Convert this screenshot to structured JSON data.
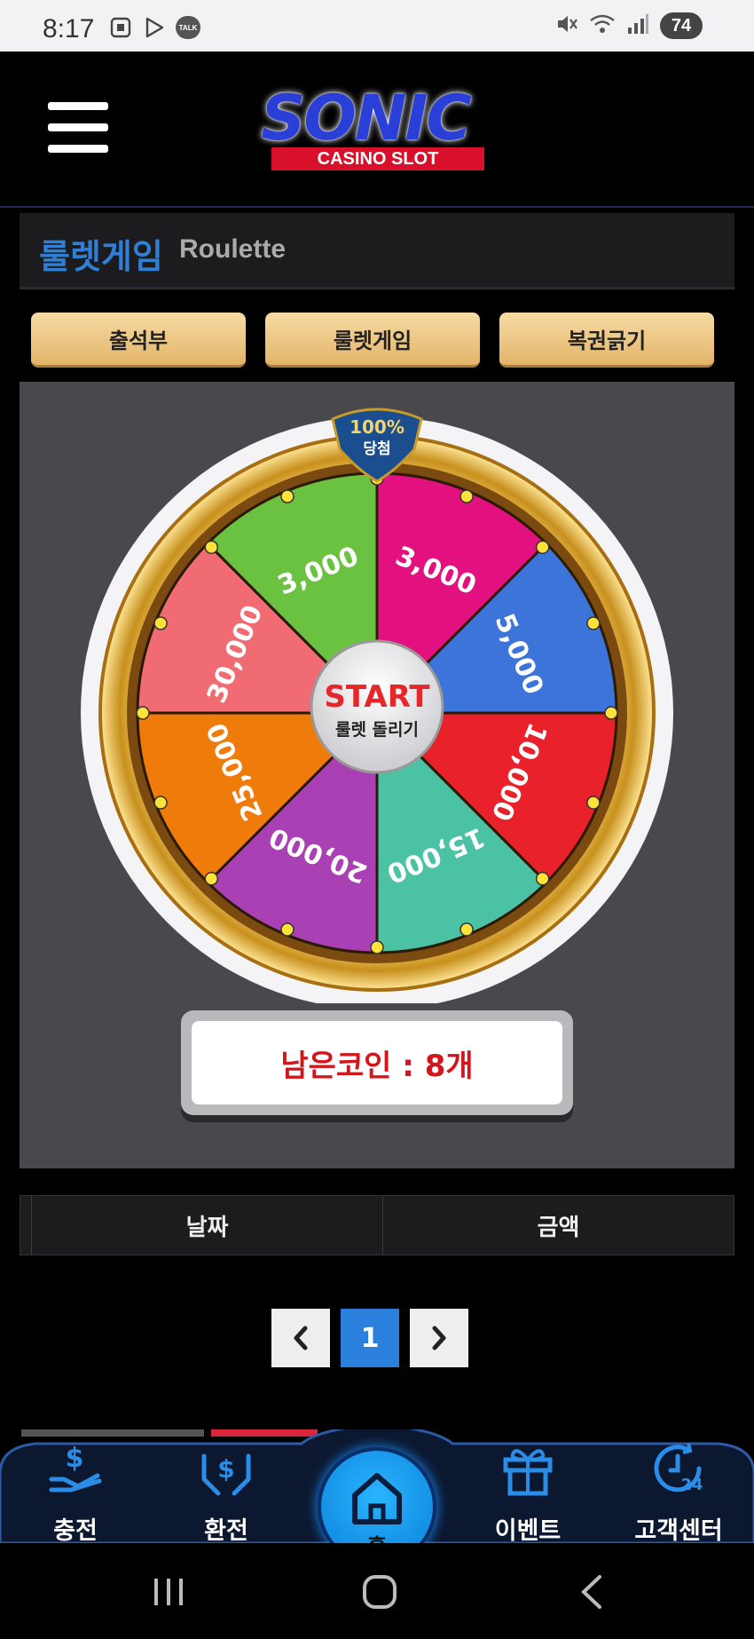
{
  "status_bar": {
    "time": "8:17",
    "talk_badge": "TALK",
    "battery": "74"
  },
  "header": {
    "logo_text": "SONIC",
    "logo_sub": "CASINO SLOT"
  },
  "title": {
    "korean": "룰렛게임",
    "english": "Roulette"
  },
  "tabs": [
    {
      "label": "출석부"
    },
    {
      "label": "룰렛게임"
    },
    {
      "label": "복권긁기"
    }
  ],
  "wheel": {
    "badge_percent": "100%",
    "badge_text": "당첨",
    "center_title": "START",
    "center_subtitle": "룰렛 돌리기",
    "segments": [
      {
        "label": "3,000",
        "color": "#e3117f"
      },
      {
        "label": "5,000",
        "color": "#3d74da"
      },
      {
        "label": "10,000",
        "color": "#e8212a"
      },
      {
        "label": "15,000",
        "color": "#4cc2a4"
      },
      {
        "label": "20,000",
        "color": "#a940b3"
      },
      {
        "label": "25,000",
        "color": "#ef7b0a"
      },
      {
        "label": "30,000",
        "color": "#f06c72"
      },
      {
        "label": "3,000",
        "color": "#6ac240"
      }
    ]
  },
  "coins": {
    "text": "남은코인 : 8개"
  },
  "table": {
    "columns": [
      "날짜",
      "금액"
    ]
  },
  "pagination": {
    "prev": "‹",
    "current": "1",
    "next": "›"
  },
  "bottom_nav": {
    "items": [
      {
        "label": "충전",
        "icon": "hand-dollar-icon"
      },
      {
        "label": "환전",
        "icon": "hands-dollar-icon"
      },
      {
        "label": "홈",
        "icon": "home-icon"
      },
      {
        "label": "이벤트",
        "icon": "gift-icon"
      },
      {
        "label": "고객센터",
        "icon": "clock-24-icon"
      }
    ]
  },
  "colors": {
    "accent_blue": "#2f7fd6",
    "gold": "#e3b46a",
    "coin_red": "#d2161c"
  }
}
